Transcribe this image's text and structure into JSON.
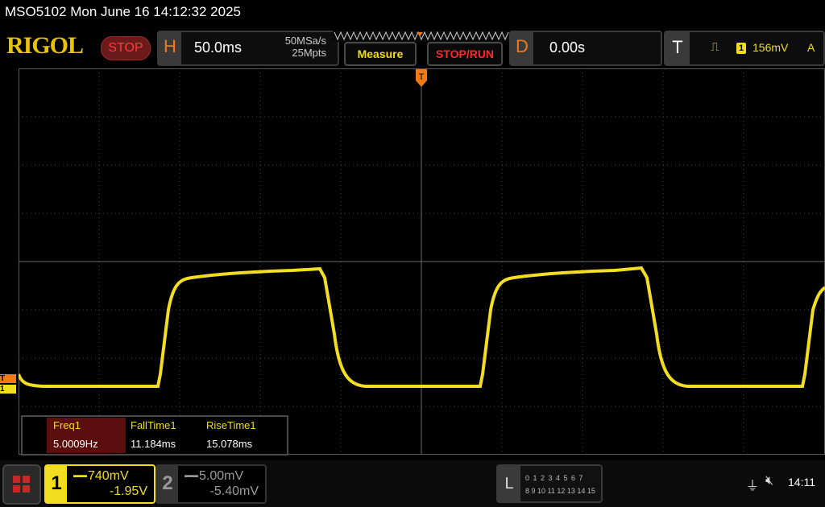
{
  "title_bar": {
    "text": "MSO5102  Mon June 16 14:12:32 2025"
  },
  "brand": {
    "logo": "RIGOL",
    "run_state": "STOP"
  },
  "horizontal": {
    "letter": "H",
    "timebase": "50.0ms",
    "sample_rate": "50MSa/s",
    "memory_depth": "25Mpts"
  },
  "buttons": {
    "measure": "Measure",
    "stop_run": "STOP/RUN"
  },
  "delay": {
    "letter": "D",
    "value": "0.00s"
  },
  "trigger": {
    "letter": "T",
    "source": "1",
    "level": "156mV",
    "mode": "A"
  },
  "markers": {
    "trigger_level": "T",
    "channel1_level": "1"
  },
  "measurements": {
    "headers": [
      "Freq1",
      "FallTime1",
      "RiseTime1"
    ],
    "values": [
      "5.0009Hz",
      "11.184ms",
      "15.078ms"
    ]
  },
  "channels": [
    {
      "number": "1",
      "scale": "740mV",
      "offset": "-1.95V",
      "color": "#f2dd20"
    },
    {
      "number": "2",
      "scale": "5.00mV",
      "offset": "-5.40mV",
      "color": "#9a9a9a"
    }
  ],
  "logic": {
    "letter": "L",
    "row1": "0 1 2 3   4 5 6 7",
    "row2": "8 9 10 11 12 13 14 15"
  },
  "status": {
    "clock": "14:11",
    "usb_icon": "usb-icon",
    "speaker_icon": "speaker-muted-icon"
  },
  "colors": {
    "trace": "#f2dd20",
    "accent": "#f07a17",
    "stop": "#ff2828"
  }
}
